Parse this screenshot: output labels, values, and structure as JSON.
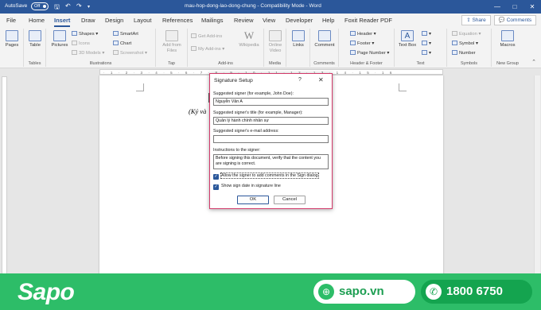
{
  "titlebar": {
    "autosave_label": "AutoSave",
    "autosave_state": "Off",
    "document_title": "mau-hop-dong-lao-dong-chung  -  Compatibility Mode  -  Word",
    "window_buttons": [
      "—",
      "□",
      "✕"
    ]
  },
  "ribbon": {
    "tabs": [
      "File",
      "Home",
      "Insert",
      "Draw",
      "Design",
      "Layout",
      "References",
      "Mailings",
      "Review",
      "View",
      "Developer",
      "Help",
      "Foxit Reader PDF"
    ],
    "active_tab": "Insert",
    "share_label": "Share",
    "comments_label": "Comments",
    "groups": {
      "pages": {
        "button": "Pages"
      },
      "tables": {
        "button": "Table",
        "label": "Tables"
      },
      "illustrations": {
        "pictures": "Pictures",
        "shapes": "Shapes",
        "icons": "Icons",
        "models3d": "3D Models",
        "smartart": "SmartArt",
        "chart": "Chart",
        "screenshot": "Screenshot",
        "label": "Illustrations"
      },
      "tap": {
        "button": "Add from Files",
        "label": "Tap"
      },
      "addins": {
        "get": "Get Add-ins",
        "my": "My Add-ins",
        "wikipedia": "Wikipedia",
        "label": "Add-ins"
      },
      "media": {
        "button": "Online Video",
        "label": "Media"
      },
      "links": {
        "button": "Links"
      },
      "comments": {
        "button": "Comment",
        "label": "Comments"
      },
      "header_footer": {
        "header": "Header",
        "footer": "Footer",
        "page_number": "Page Number",
        "label": "Header & Footer"
      },
      "text": {
        "textbox": "Text Box",
        "label": "Text"
      },
      "symbols": {
        "equation": "Equation",
        "symbol": "Symbol",
        "number": "Number",
        "label": "Symbols"
      },
      "newgroup": {
        "button": "Macros",
        "label": "New Group"
      }
    }
  },
  "document": {
    "visible_text": "(Ký và"
  },
  "dialog": {
    "title": "Signature Setup",
    "help": "?",
    "close": "✕",
    "signer_label": "Suggested signer (for example, John Doe):",
    "signer_value": "Nguyễn Văn A",
    "title_label": "Suggested signer's title (for example, Manager):",
    "title_value": "Quản lý hành chính nhân sự",
    "email_label": "Suggested signer's e-mail address:",
    "email_value": "",
    "instructions_label": "Instructions to the signer:",
    "instructions_value": "Before signing this document, verify that the content you are signing is correct.",
    "allow_comments_label": "Allow the signer to add comments in the Sign dialog",
    "allow_comments_checked": true,
    "show_date_label": "Show sign date in signature line",
    "show_date_checked": true,
    "ok_label": "OK",
    "cancel_label": "Cancel"
  },
  "footer": {
    "brand": "Sapo",
    "website": "sapo.vn",
    "phone": "1800 6750",
    "colors": {
      "brand_green": "#2dbd68",
      "word_blue": "#2b579a",
      "dialog_border": "#d23a6a"
    }
  }
}
